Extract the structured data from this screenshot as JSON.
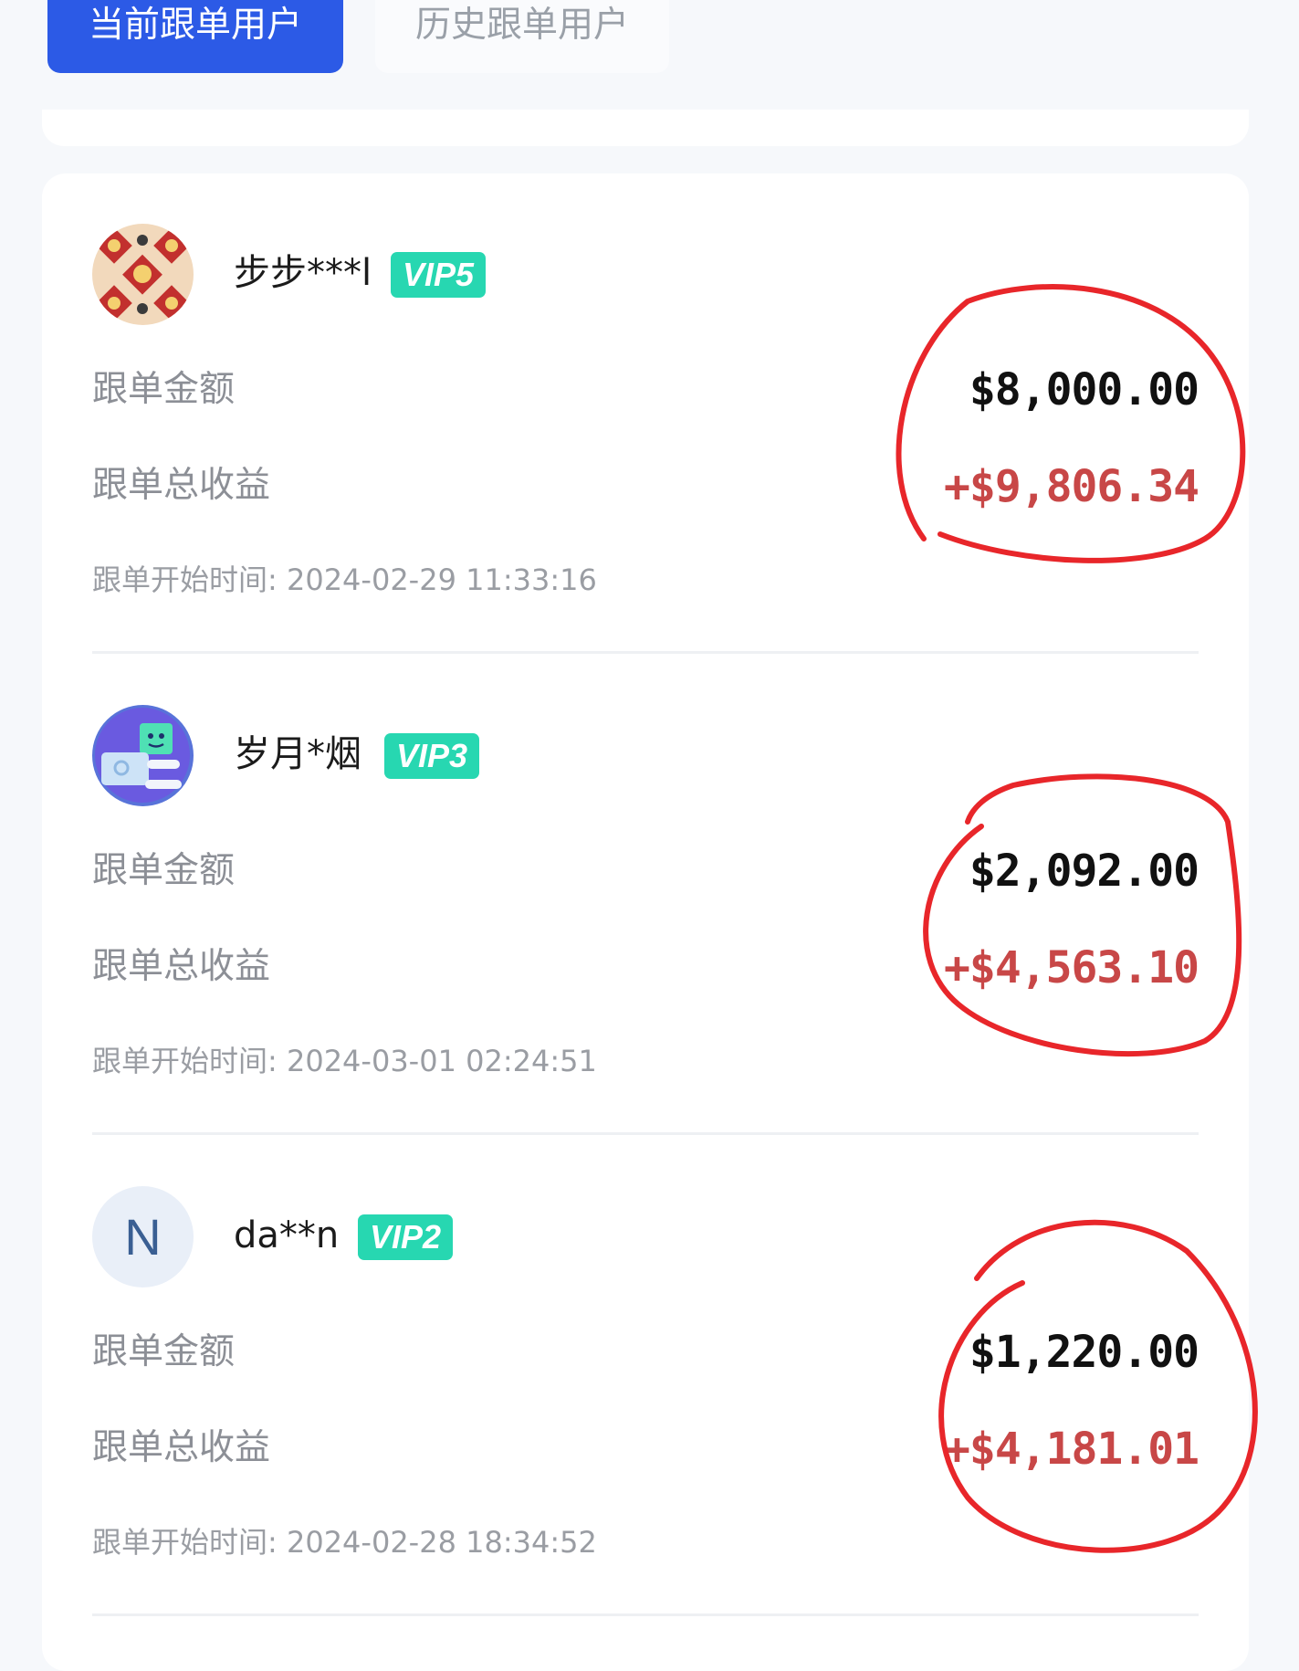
{
  "tabs": {
    "current": "当前跟单用户",
    "history": "历史跟单用户"
  },
  "labels": {
    "amount": "跟单金额",
    "total_profit": "跟单总收益",
    "start_time_prefix": "跟单开始时间: "
  },
  "entries": [
    {
      "username": "步步***l",
      "vip": "VIP5",
      "amount": "$8,000.00",
      "profit": "+$9,806.34",
      "start_time": "2024-02-29 11:33:16",
      "avatar": "new-year-poster-avatar"
    },
    {
      "username": "岁月*烟",
      "vip": "VIP3",
      "amount": "$2,092.00",
      "profit": "+$4,563.10",
      "start_time": "2024-03-01 02:24:51",
      "avatar": "cartoon-computer-avatar"
    },
    {
      "username": "da**n",
      "vip": "VIP2",
      "amount": "$1,220.00",
      "profit": "+$4,181.01",
      "start_time": "2024-02-28 18:34:52",
      "avatar": "letter-avatar",
      "avatar_letter": "N"
    }
  ],
  "colors": {
    "primary": "#2c5ae6",
    "vip_badge": "#27d7b1",
    "profit": "#c84747",
    "annotation": "#e8262a"
  }
}
